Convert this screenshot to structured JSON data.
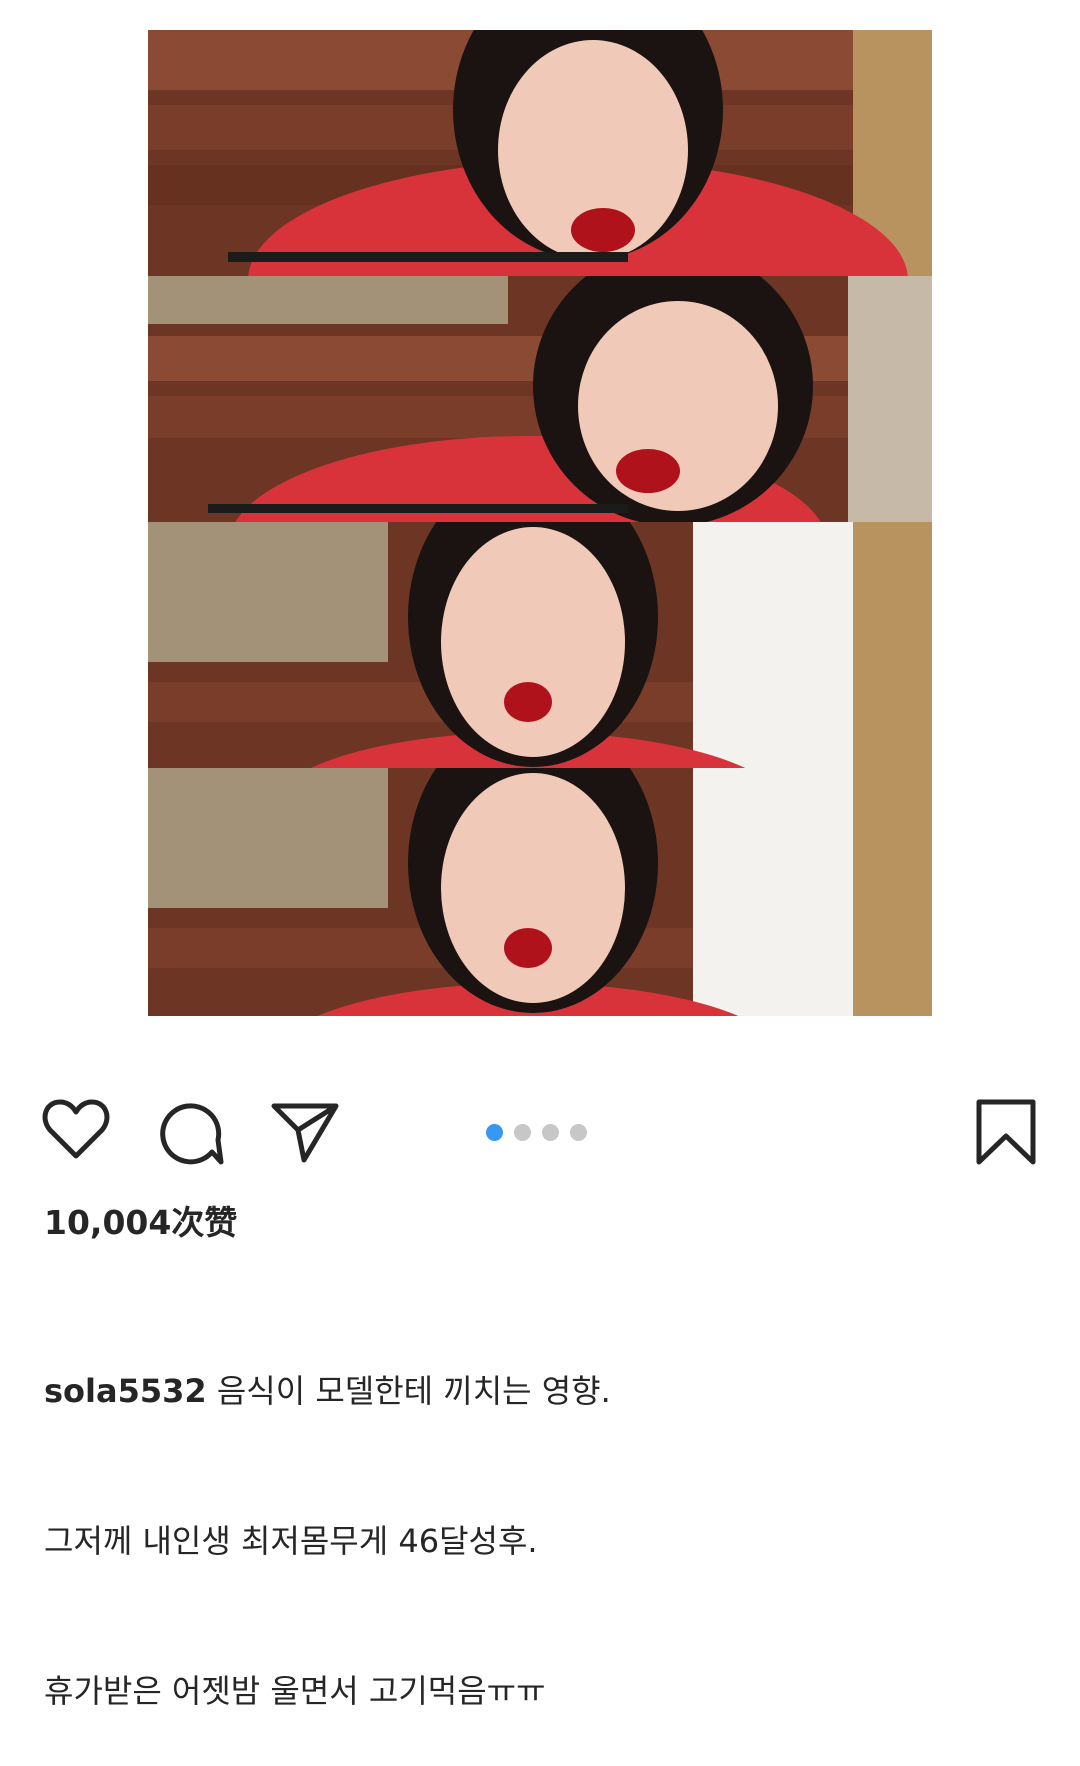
{
  "post": {
    "media_description_panels": 4,
    "carousel": {
      "count": 4,
      "active_index": 0
    },
    "likes_text": "10,004次赞",
    "username": "sola5532",
    "caption_lines": [
      "음식이 모델한테 끼치는 영향.",
      "그저께 내인생 최저몸무게 46달성후.",
      "휴가받은 어젯밤 울면서 고기먹음ㅠㅠ"
    ]
  },
  "icons": {
    "like": "heart-icon",
    "comment": "comment-bubble-icon",
    "share": "paper-plane-icon",
    "save": "bookmark-icon"
  },
  "colors": {
    "active_dot": "#3897f0",
    "inactive_dot": "#c7c7c7",
    "text": "#262626",
    "shirt_red": "#d8333a"
  }
}
